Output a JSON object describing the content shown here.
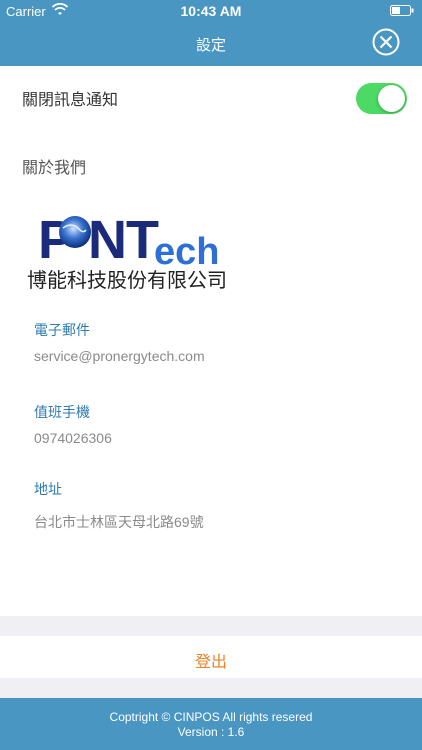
{
  "status_bar": {
    "carrier": "Carrier",
    "time": "10:43 AM",
    "wifi_icon": "wifi-icon",
    "battery_icon": "battery-icon"
  },
  "header": {
    "title": "設定",
    "close_icon": "close-circle-icon"
  },
  "settings": {
    "notify_label": "關閉訊息通知",
    "notify_enabled": true
  },
  "about": {
    "title": "關於我們",
    "logo_text": "PNTech",
    "company_name": "博能科技股份有限公司",
    "email_label": "電子郵件",
    "email_value": "service@pronergytech.com",
    "phone_label": "值班手機",
    "phone_value": "0974026306",
    "address_label": "地址",
    "address_value": "台北市士林區天母北路69號"
  },
  "logout_label": "登出",
  "footer": {
    "copyright": "Coptright ©  CINPOS All rights resered",
    "version": "Version : 1.6"
  },
  "colors": {
    "header": "#4a96c3",
    "toggle_on": "#4cd964",
    "link_blue": "#2f7bb0",
    "logout": "#e8832a"
  }
}
